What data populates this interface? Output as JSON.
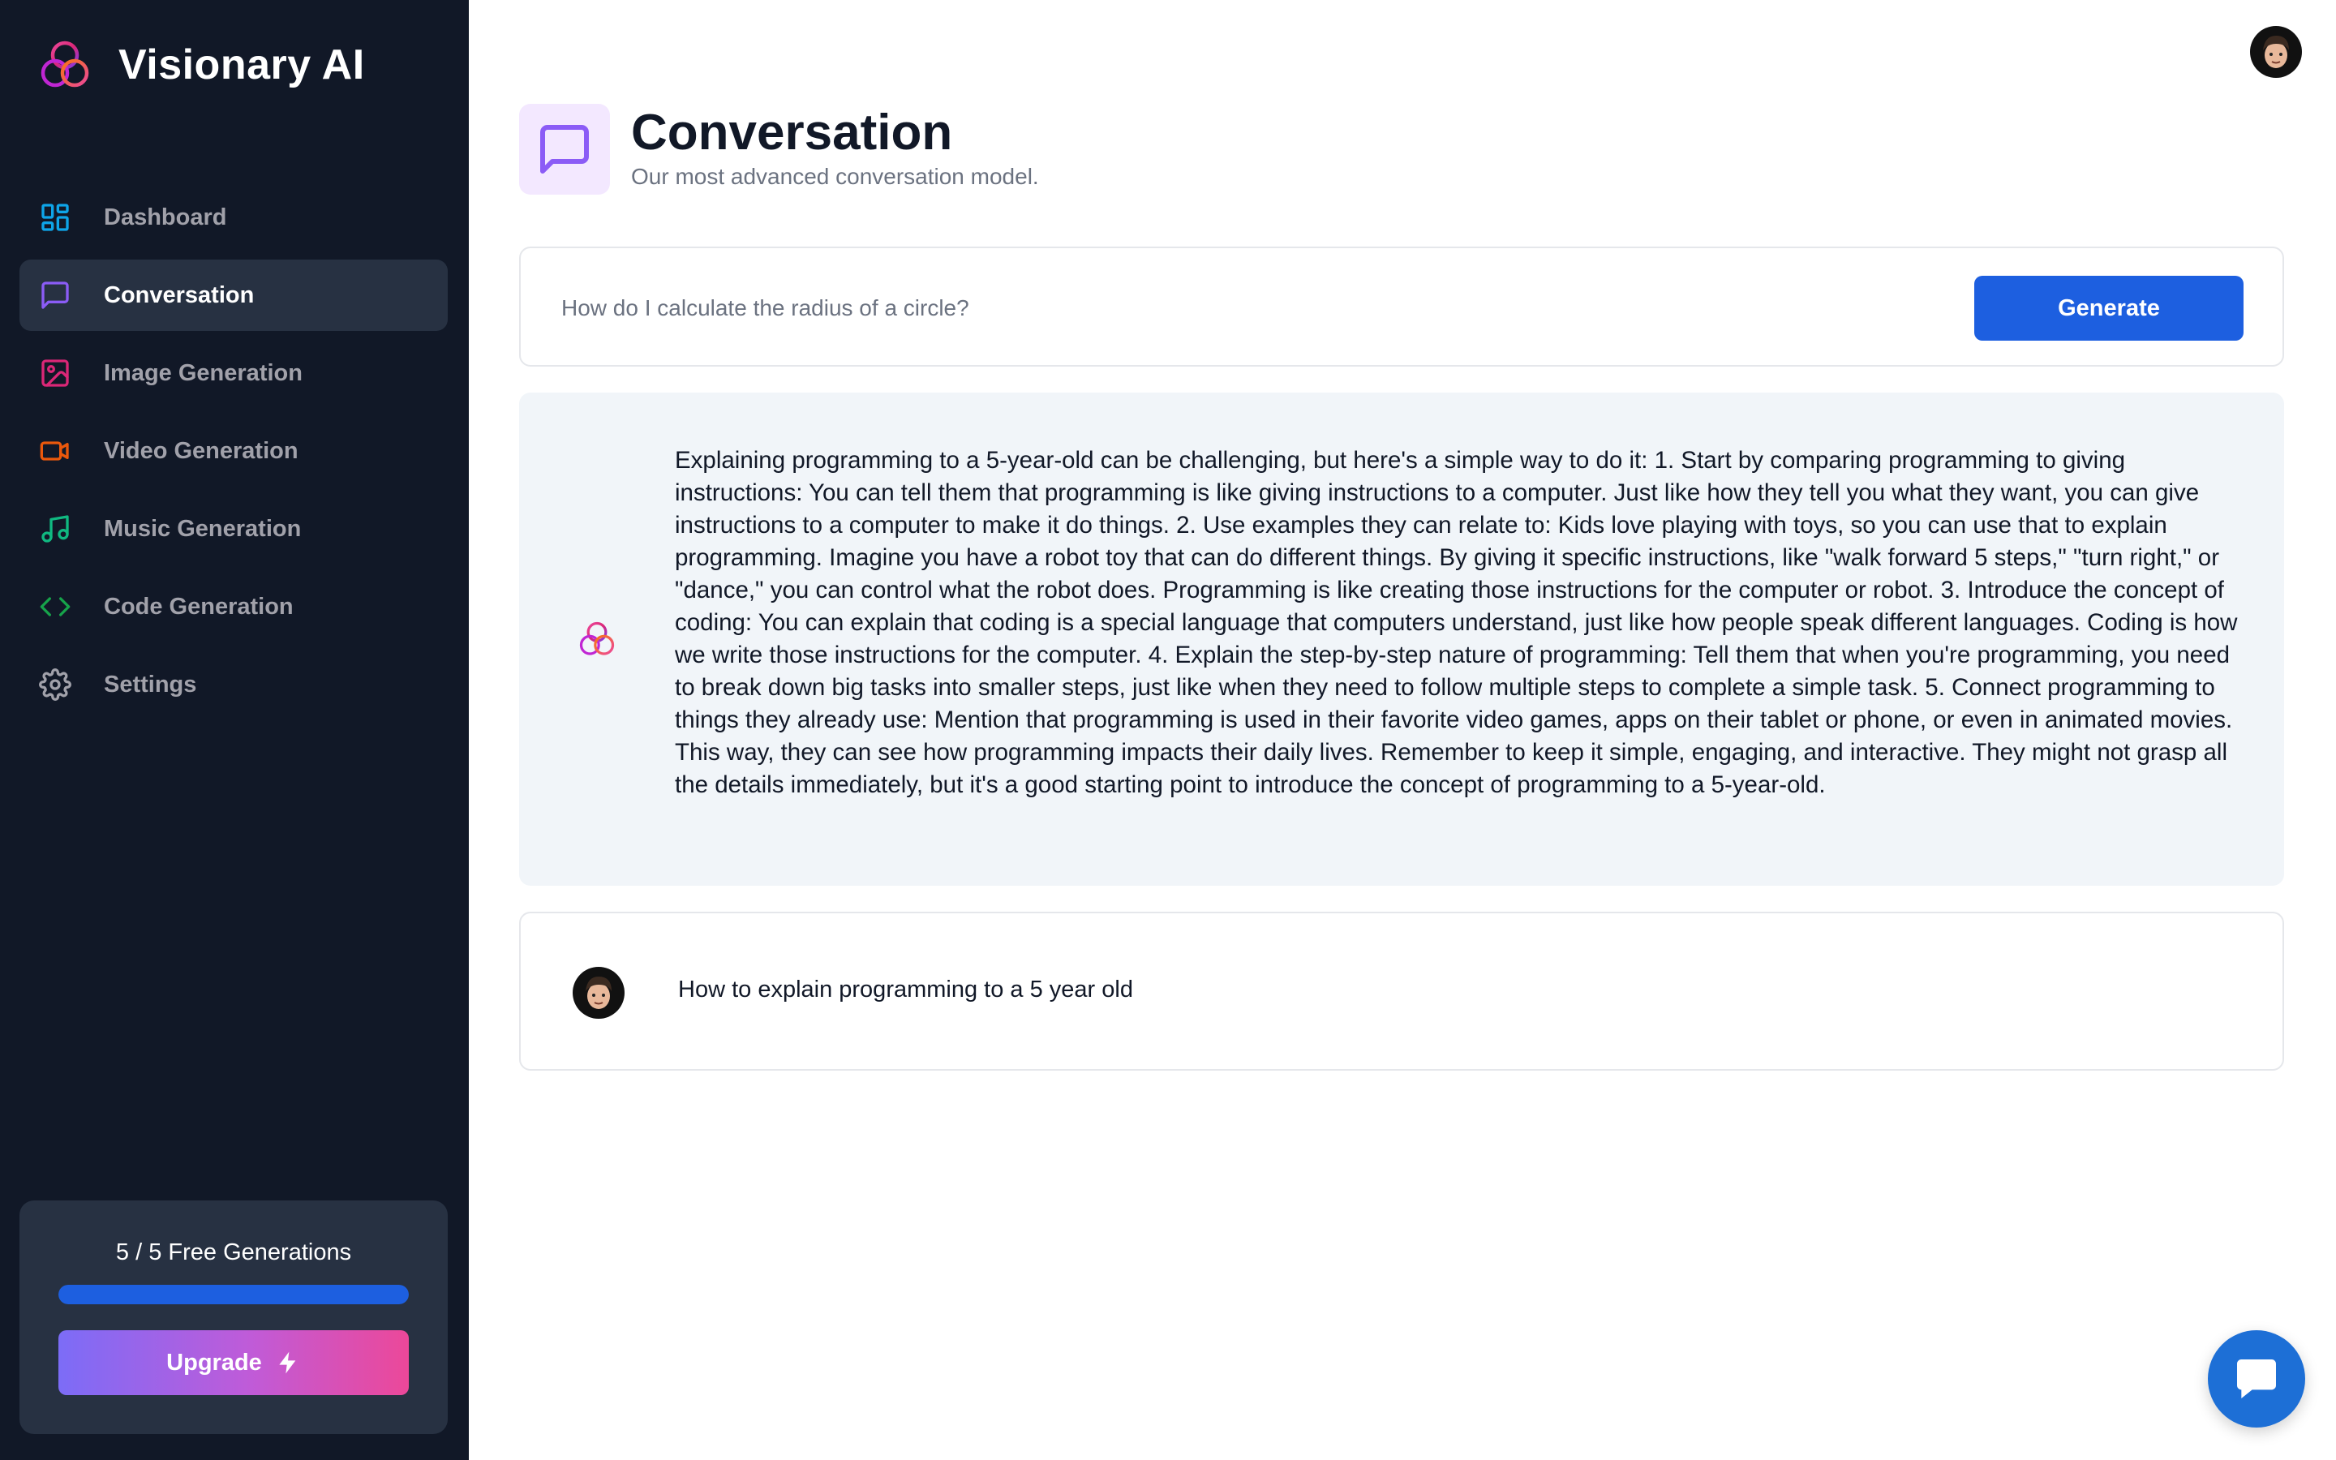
{
  "app": {
    "name": "Visionary AI"
  },
  "sidebar": {
    "items": [
      {
        "label": "Dashboard",
        "icon": "dashboard-grid-icon",
        "color": "#0ea5e9"
      },
      {
        "label": "Conversation",
        "icon": "chat-bubble-icon",
        "color": "#8b5cf6",
        "active": true
      },
      {
        "label": "Image Generation",
        "icon": "image-icon",
        "color": "#db2777"
      },
      {
        "label": "Video Generation",
        "icon": "video-camera-icon",
        "color": "#ea580c"
      },
      {
        "label": "Music Generation",
        "icon": "music-note-icon",
        "color": "#10b981"
      },
      {
        "label": "Code Generation",
        "icon": "code-brackets-icon",
        "color": "#16a34a"
      },
      {
        "label": "Settings",
        "icon": "gear-icon",
        "color": "#a1a1aa"
      }
    ],
    "usage": {
      "text": "5 / 5 Free Generations",
      "used": 5,
      "limit": 5,
      "progress_fraction": 1.0
    },
    "upgrade_label": "Upgrade"
  },
  "header": {
    "title": "Conversation",
    "subtitle": "Our most advanced conversation model."
  },
  "prompt": {
    "placeholder": "How do I calculate the radius of a circle?",
    "value": "",
    "generate_label": "Generate"
  },
  "messages": [
    {
      "role": "assistant",
      "text": "Explaining programming to a 5-year-old can be challenging, but here's a simple way to do it: 1. Start by comparing programming to giving instructions: You can tell them that programming is like giving instructions to a computer. Just like how they tell you what they want, you can give instructions to a computer to make it do things. 2. Use examples they can relate to: Kids love playing with toys, so you can use that to explain programming. Imagine you have a robot toy that can do different things. By giving it specific instructions, like \"walk forward 5 steps,\" \"turn right,\" or \"dance,\" you can control what the robot does. Programming is like creating those instructions for the computer or robot. 3. Introduce the concept of coding: You can explain that coding is a special language that computers understand, just like how people speak different languages. Coding is how we write those instructions for the computer. 4. Explain the step-by-step nature of programming: Tell them that when you're programming, you need to break down big tasks into smaller steps, just like when they need to follow multiple steps to complete a simple task. 5. Connect programming to things they already use: Mention that programming is used in their favorite video games, apps on their tablet or phone, or even in animated movies. This way, they can see how programming impacts their daily lives. Remember to keep it simple, engaging, and interactive. They might not grasp all the details immediately, but it's a good starting point to introduce the concept of programming to a 5-year-old."
    },
    {
      "role": "user",
      "text": "How to explain programming to a 5 year old"
    }
  ],
  "colors": {
    "sidebar_bg": "#111827",
    "active_item_bg": "#273142",
    "primary": "#1d5fe0",
    "assistant_bubble_bg": "#f1f5f9",
    "chat_fab": "#1d6fd6"
  }
}
